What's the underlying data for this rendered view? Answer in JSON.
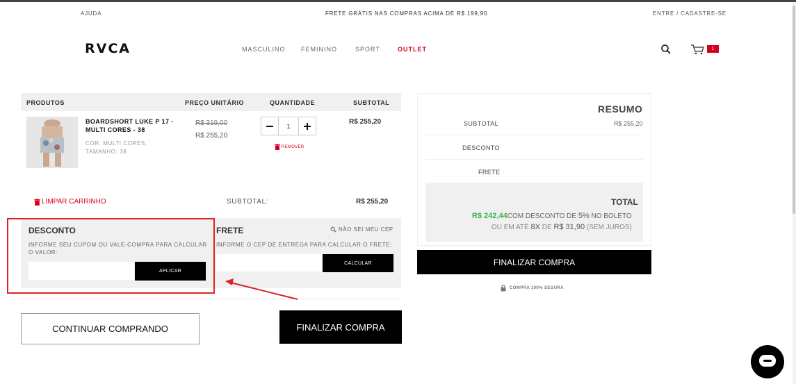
{
  "topbar": {
    "help": "AJUDA",
    "promo": "FRETE GRÁTIS NAS COMPRAS ACIMA DE R$ 199,90",
    "login": "ENTRE / CADASTRE-SE"
  },
  "header": {
    "logo": "RVCA",
    "nav": [
      "MASCULINO",
      "FEMININO",
      "SPORT",
      "OUTLET"
    ],
    "cart_count": "1"
  },
  "cart": {
    "columns": [
      "PRODUTOS",
      "PREÇO UNITÁRIO",
      "QUANTIDADE",
      "SUBTOTAL"
    ],
    "item": {
      "name_line1": "BOARDSHORT LUKE P 17 -",
      "name_line2": "MULTI CORES - 38",
      "attr_line1": "COR: MULTI CORES,",
      "attr_line2": "TAMANHO: 38",
      "old_price": "R$ 319,00",
      "price": "R$ 255,20",
      "qty": "1",
      "remove": "REMOVER",
      "subtotal": "R$ 255,20"
    },
    "clear": "LIMPAR CARRINHO",
    "subtotal_label": "SUBTOTAL:",
    "subtotal_value": "R$ 255,20"
  },
  "discount": {
    "title": "DESCONTO",
    "desc_line1": "INFORME SEU CUPOM OU VALE-COMPRA PARA CALCULAR",
    "desc_line2": "O VALOR:",
    "input_value": "",
    "apply": "APLICAR"
  },
  "shipping": {
    "title": "FRETE",
    "unknown_cep": "NÃO SEI MEU CEP",
    "desc": "INFORME O CEP DE ENTREGA PARA CALCULAR O FRETE:",
    "input_value": "",
    "calc": "CALCULAR"
  },
  "actions": {
    "continue": "CONTINUAR COMPRANDO",
    "checkout": "FINALIZAR COMPRA"
  },
  "summary": {
    "title": "RESUMO",
    "subtotal_label": "SUBTOTAL",
    "subtotal_value": "R$ 255,20",
    "discount_label": "DESCONTO",
    "shipping_label": "FRETE",
    "total_label": "TOTAL",
    "total_value": "R$ 242,44",
    "boleto_text": "COM DESCONTO DE",
    "boleto_pct": "5%",
    "boleto_suffix": "NO BOLETO",
    "installments_prefix": "OU EM ATÉ",
    "installments_count": "8X",
    "installments_de": "DE",
    "installments_value": "R$ 31,90",
    "installments_suffix": "(SEM JUROS)",
    "checkout": "FINALIZAR COMPRA",
    "secure": "COMPRA 100% SEGURA"
  },
  "colors": {
    "accent_red": "#d6001c",
    "green": "#3cb54a",
    "annotation_red": "#e02020"
  }
}
